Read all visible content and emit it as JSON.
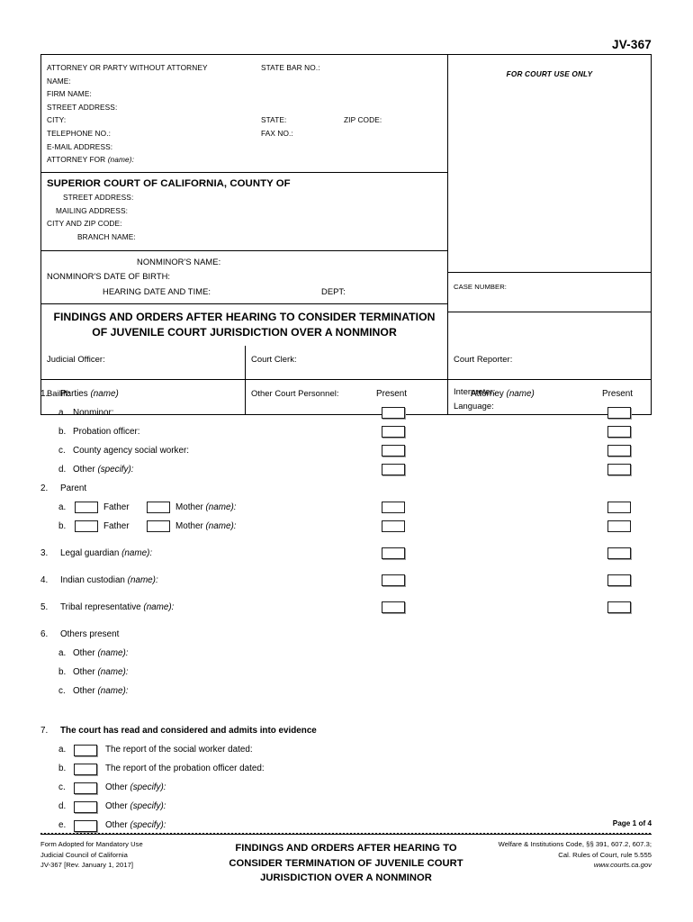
{
  "form": {
    "number": "JV-367",
    "court_use_label": "FOR COURT USE ONLY",
    "case_number_label": "CASE NUMBER:",
    "title_line1": "FINDINGS AND ORDERS AFTER HEARING TO CONSIDER TERMINATION",
    "title_line2": "OF JUVENILE COURT JURISDICTION OVER A NONMINOR"
  },
  "attorney": {
    "heading": "ATTORNEY OR PARTY WITHOUT ATTORNEY",
    "state_bar_label": "STATE BAR NO.:",
    "name_label": "NAME:",
    "firm_label": "FIRM NAME:",
    "street_label": "STREET ADDRESS:",
    "city_label": "CITY:",
    "state_label": "STATE:",
    "zip_label": "ZIP CODE:",
    "telephone_label": "TELEPHONE NO.:",
    "fax_label": "FAX NO.:",
    "email_label": "E-MAIL ADDRESS:",
    "attorney_for_label": "ATTORNEY FOR",
    "attorney_for_italic": "(name):"
  },
  "court": {
    "heading": "SUPERIOR COURT OF CALIFORNIA, COUNTY OF",
    "street_label": "STREET ADDRESS:",
    "mailing_label": "MAILING ADDRESS:",
    "city_zip_label": "CITY AND ZIP CODE:",
    "branch_label": "BRANCH NAME:"
  },
  "nonminor": {
    "name_label": "NONMINOR'S NAME:",
    "dob_label": "NONMINOR'S DATE OF BIRTH:",
    "hearing_label": "HEARING DATE AND TIME:",
    "dept_label": "DEPT:"
  },
  "personnel": {
    "judicial_officer": "Judicial Officer:",
    "court_clerk": "Court Clerk:",
    "court_reporter": "Court Reporter:",
    "bailiff": "Bailiff:",
    "other_court_personnel": "Other Court Personnel:",
    "interpreter": "Interpreter:",
    "language": "Language:"
  },
  "columns": {
    "present1": "Present",
    "attorney": "Attorney",
    "attorney_italic": "(name)",
    "present2": "Present"
  },
  "items": [
    {
      "num": "1.",
      "text": "Parties",
      "italic": "(name)",
      "subs": [
        {
          "letter": "a.",
          "text": "Nonminor:",
          "italic": "",
          "present1": true,
          "present2": true
        },
        {
          "letter": "b.",
          "text": "Probation officer:",
          "italic": "",
          "present1": true,
          "present2": true
        },
        {
          "letter": "c.",
          "text": "County agency social worker:",
          "italic": "",
          "present1": true,
          "present2": true
        },
        {
          "letter": "d.",
          "text": "Other",
          "italic": "(specify):",
          "present1": true,
          "present2": true
        }
      ]
    },
    {
      "num": "2.",
      "text": "Parent",
      "italic": "",
      "parent_subs": [
        {
          "letter": "a.",
          "father": "Father",
          "mother": "Mother",
          "italic": "(name):"
        },
        {
          "letter": "b.",
          "father": "Father",
          "mother": "Mother",
          "italic": "(name):"
        }
      ]
    },
    {
      "num": "3.",
      "text": "Legal guardian",
      "italic": "(name):",
      "present1": true,
      "present2": true
    },
    {
      "num": "4.",
      "text": "Indian custodian",
      "italic": "(name):",
      "present1": true,
      "present2": true
    },
    {
      "num": "5.",
      "text": "Tribal representative",
      "italic": "(name):",
      "present1": true,
      "present2": true
    },
    {
      "num": "6.",
      "text": "Others present",
      "italic": "",
      "subs": [
        {
          "letter": "a.",
          "text": "Other",
          "italic": "(name):"
        },
        {
          "letter": "b.",
          "text": "Other",
          "italic": "(name):"
        },
        {
          "letter": "c.",
          "text": "Other",
          "italic": "(name):"
        }
      ]
    },
    {
      "num": "7.",
      "text": "The court has read and considered and admits into evidence",
      "italic": "",
      "bold": true,
      "checkbox_subs": [
        {
          "letter": "a.",
          "text": "The report of the social worker dated:",
          "italic": ""
        },
        {
          "letter": "b.",
          "text": "The report of the probation officer dated:",
          "italic": ""
        },
        {
          "letter": "c.",
          "text": "Other",
          "italic": "(specify):"
        },
        {
          "letter": "d.",
          "text": "Other",
          "italic": "(specify):"
        },
        {
          "letter": "e.",
          "text": "Other",
          "italic": "(specify):"
        }
      ]
    }
  ],
  "footer": {
    "page_of": "Page 1 of 4",
    "adopted_line1": "Form Adopted for Mandatory Use",
    "adopted_line2": "Judicial Council of California",
    "adopted_line3": "JV-367 [Rev. January 1, 2017]",
    "center_line1": "FINDINGS AND ORDERS AFTER HEARING TO",
    "center_line2": "CONSIDER TERMINATION OF JUVENILE COURT",
    "center_line3": "JURISDICTION OVER A NONMINOR",
    "right_line1": "Welfare & Institutions Code, §§ 391, 607.2, 607.3;",
    "right_line2": "Cal. Rules of Court, rule 5.555",
    "right_line3": "www.courts.ca.gov"
  }
}
